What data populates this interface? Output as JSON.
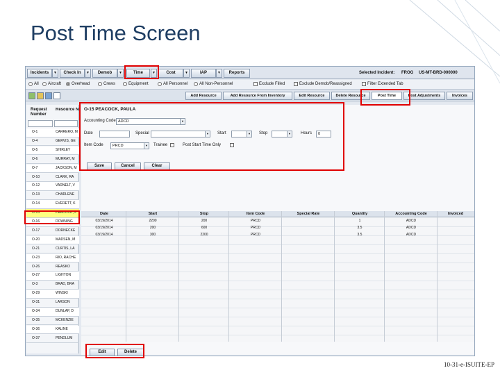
{
  "slide": {
    "title": "Post Time Screen",
    "footer": "10-31-e-ISUITE-EP"
  },
  "menu": {
    "items": [
      "Incidents",
      "Check In",
      "Demob",
      "Time",
      "Cost",
      "IAP",
      "Reports"
    ],
    "selected_label": "Selected Incident:",
    "selected_name": "FROG",
    "selected_number": "US-MT-BRD-000000"
  },
  "filters": {
    "options": [
      "All",
      "Aircraft",
      "Overhead",
      "Crews",
      "Equipment",
      "All Personnel",
      "All Non-Personnel"
    ],
    "checks": [
      "Exclude Filled",
      "Exclude Demob/Reassigned",
      "Filter Extended Tab"
    ]
  },
  "tabs": [
    "Add Resource",
    "Add Resource From Inventory",
    "Edit Resource",
    "Delete Resource",
    "Post Time",
    "Post Adjustments",
    "Invoices"
  ],
  "left_panel": {
    "col1": "Request Number",
    "col2": "Resource Name",
    "rows": [
      {
        "req": "O-1",
        "name": "CARRERO, M"
      },
      {
        "req": "O-4",
        "name": "GERVIS, GE"
      },
      {
        "req": "O-5",
        "name": "SHIRLEY"
      },
      {
        "req": "O-6",
        "name": "MURRAY, M"
      },
      {
        "req": "O-7",
        "name": "JACKSON, M"
      },
      {
        "req": "O-10",
        "name": "CLARK, RA"
      },
      {
        "req": "O-12",
        "name": "VARNELT, V"
      },
      {
        "req": "O-13",
        "name": "CHARLENE"
      },
      {
        "req": "O-14",
        "name": "EVERETT, K"
      },
      {
        "req": "O-15",
        "name": "PEACOCK, F"
      },
      {
        "req": "O-16",
        "name": "DOWNING"
      },
      {
        "req": "O-17",
        "name": "DORNECKE"
      },
      {
        "req": "O-20",
        "name": "MADSEN, M"
      },
      {
        "req": "O-21",
        "name": "CURTIS, LA"
      },
      {
        "req": "O-23",
        "name": "RIO, RACHE"
      },
      {
        "req": "O-26",
        "name": "REASKO"
      },
      {
        "req": "O-27",
        "name": "LIGHTON"
      },
      {
        "req": "O-3",
        "name": "BRAD, BRA"
      },
      {
        "req": "O-29",
        "name": "WINSKI"
      },
      {
        "req": "O-31",
        "name": "LARSON"
      },
      {
        "req": "O-34",
        "name": "DUNLAP, D"
      },
      {
        "req": "O-35",
        "name": "MCKENZIE"
      },
      {
        "req": "O-36",
        "name": "KALINE"
      },
      {
        "req": "O-37",
        "name": "PENDLUM"
      }
    ],
    "selected_index": 9
  },
  "post_time": {
    "header": "O-15  PEACOCK, PAULA",
    "accounting_code_label": "Accounting Code",
    "accounting_code_value": "ADCD",
    "date_label": "Date",
    "special_label": "Special",
    "start_label": "Start",
    "stop_label": "Stop",
    "hours_label": "Hours",
    "hours_value": "0",
    "item_code_label": "Item Code",
    "item_code_value": "PRCD",
    "trainee_label": "Trainee",
    "post_start_label": "Post Start Time Only",
    "save": "Save",
    "cancel": "Cancel",
    "clear": "Clear"
  },
  "grid": {
    "columns": [
      "Date",
      "Start",
      "Stop",
      "Item Code",
      "Special Rate",
      "Quantity",
      "Accounting Code",
      "Invoiced"
    ],
    "rows": [
      [
        "03/19/2014",
        "2200",
        "200",
        "PRCD",
        "",
        "1",
        "ADCD",
        ""
      ],
      [
        "03/19/2014",
        "200",
        "600",
        "PRCD",
        "",
        "3.5",
        "ADCD",
        ""
      ],
      [
        "03/19/2014",
        "300",
        "2200",
        "PRCD",
        "",
        "3.5",
        "ADCD",
        ""
      ]
    ],
    "edit": "Edit",
    "delete": "Delete"
  },
  "colors": {
    "highlight": "#e00000",
    "title": "#1f3e63",
    "selected_row": "#ffff80"
  }
}
